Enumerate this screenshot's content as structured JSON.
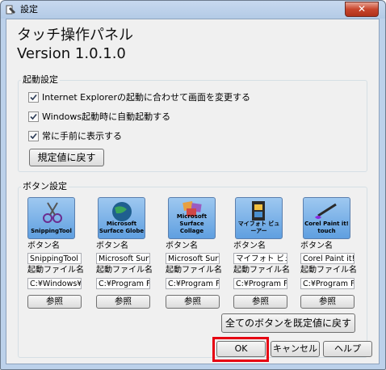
{
  "window": {
    "title": "設定",
    "close_glyph": "✕"
  },
  "heading": {
    "line1": "タッチ操作パネル",
    "line2": "Version 1.0.1.0"
  },
  "startup": {
    "group_label": "起動設定",
    "checkboxes": [
      {
        "label": "Internet Explorerの起動に合わせて画面を変更する",
        "checked": true
      },
      {
        "label": "Windows起動時に自動起動する",
        "checked": true
      },
      {
        "label": "常に手前に表示する",
        "checked": true
      }
    ],
    "reset_label": "規定値に戻す"
  },
  "buttons_group": {
    "group_label": "ボタン設定",
    "button_name_label": "ボタン名",
    "launch_file_label": "起動ファイル名",
    "browse_label": "参照",
    "items": [
      {
        "tile_label": "SnippingTool",
        "name": "SnippingTool",
        "file": "C:¥Windows¥sys",
        "icon": "scissors-icon"
      },
      {
        "tile_label": "Microsoft Surface Globe",
        "name": "Microsoft Surfac",
        "file": "C:¥Program File",
        "icon": "globe-icon"
      },
      {
        "tile_label": "Microsoft Surface Collage",
        "name": "Microsoft Surfac",
        "file": "C:¥Program File",
        "icon": "collage-icon"
      },
      {
        "tile_label": "マイフォト ビューアー",
        "name": "マイフォト ビューア",
        "file": "C:¥Program File",
        "icon": "film-icon"
      },
      {
        "tile_label": "Corel Paint it! touch",
        "name": "Corel Paint it! tc",
        "file": "C:¥Program File",
        "icon": "brush-icon"
      }
    ],
    "reset_all_label": "全てのボタンを既定値に戻す"
  },
  "footer": {
    "ok_label": "OK",
    "cancel_label": "キャンセル",
    "help_label": "ヘルプ"
  },
  "colors": {
    "highlight": "#e60012",
    "tile_blue": "#5f9fe0"
  }
}
